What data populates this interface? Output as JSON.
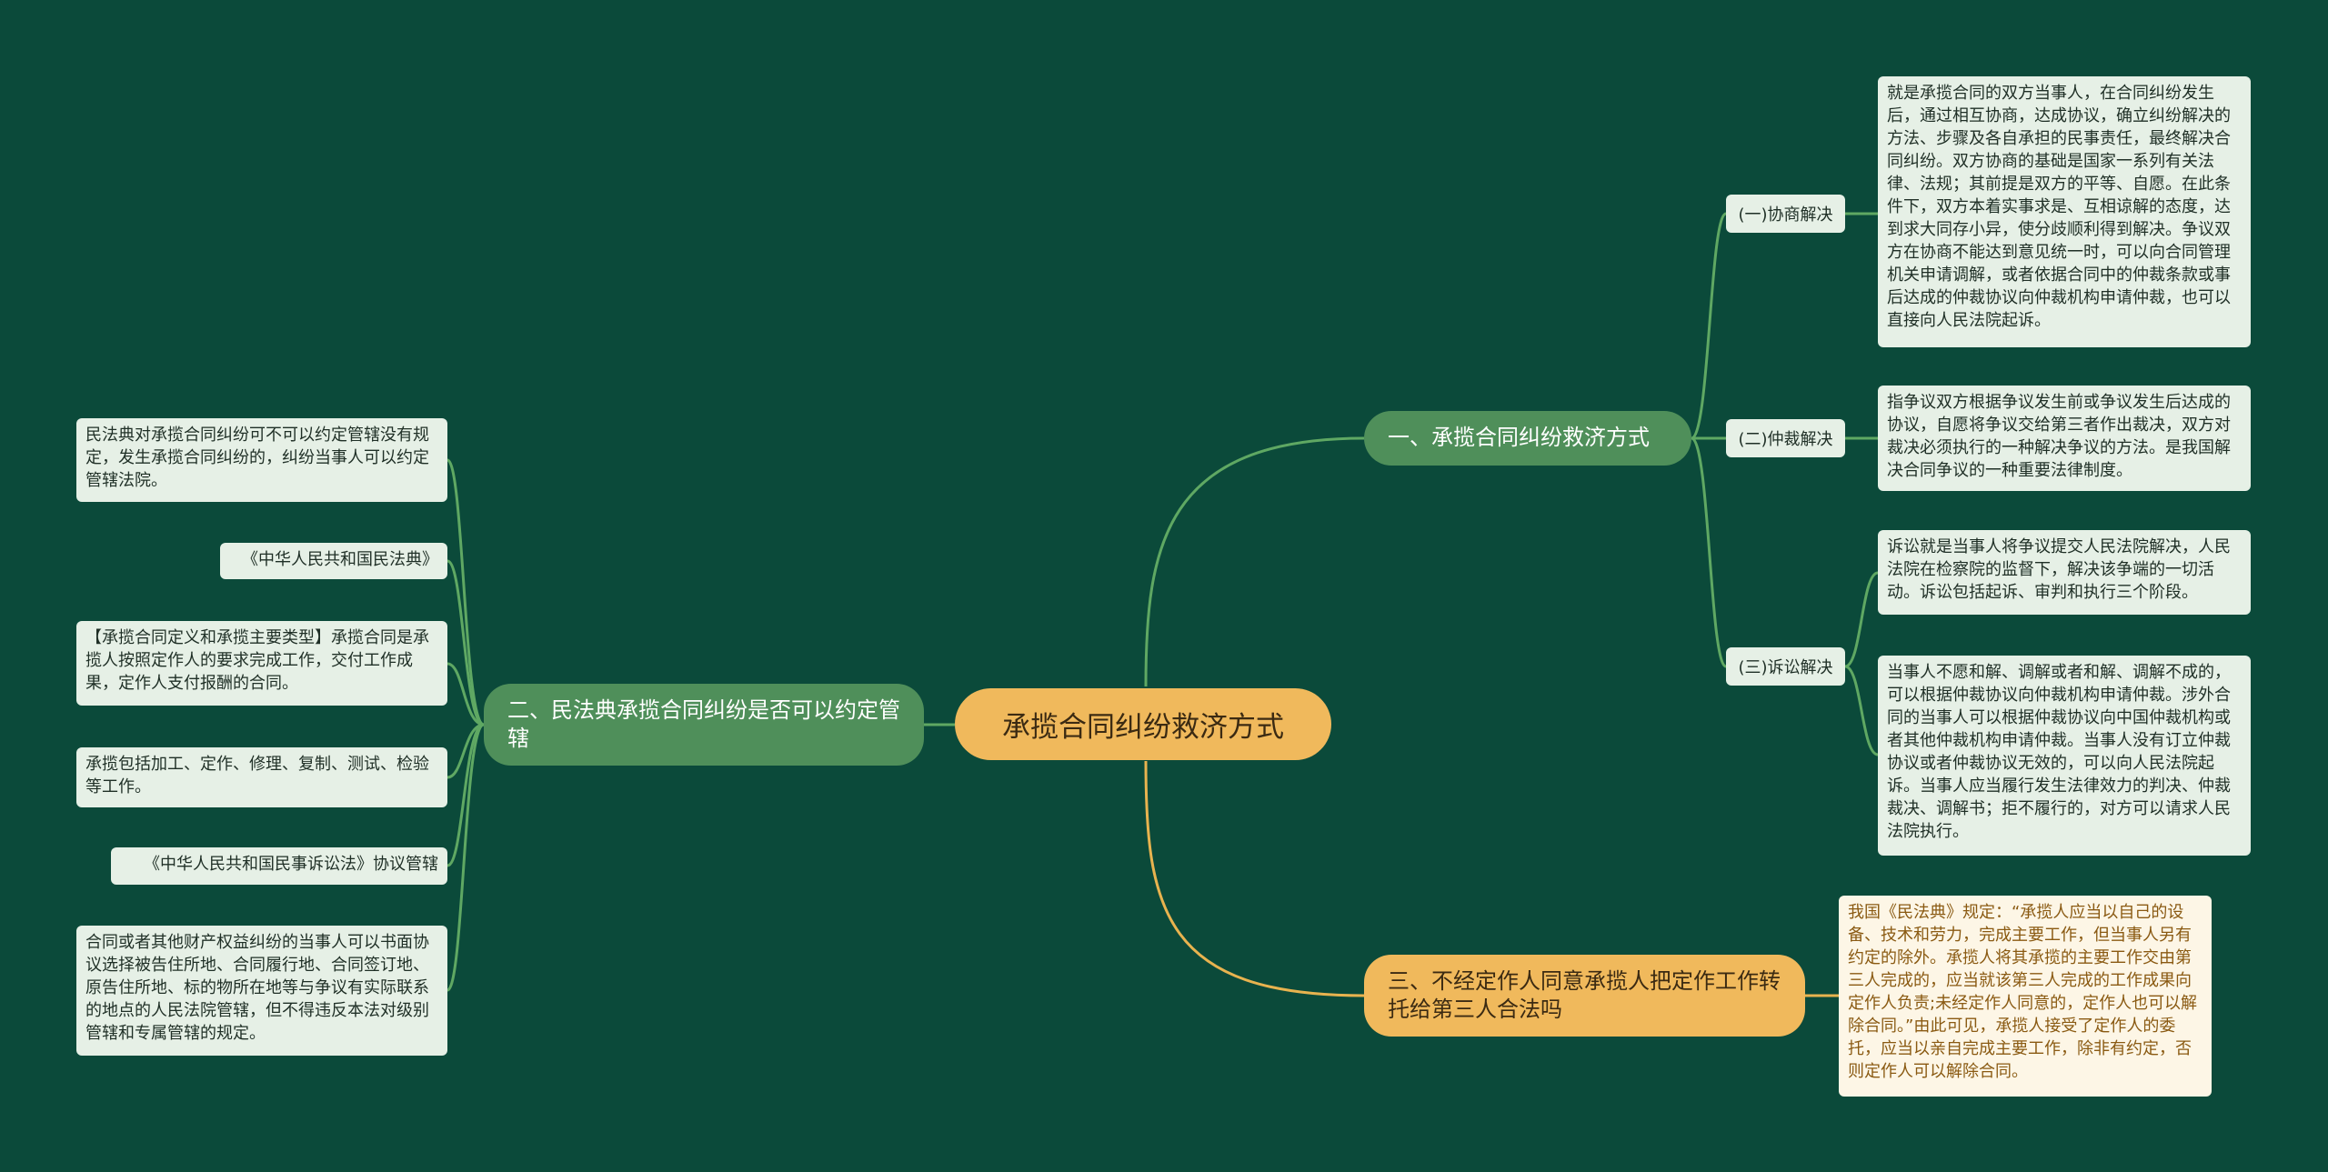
{
  "colors": {
    "background": "#0b4a3a",
    "root": "#f0b95c",
    "branch_green": "#4f8f5a",
    "branch_yellow": "#f0b95c",
    "leaf": "#e6f0e6",
    "leaf_yellow": "#fdf6e6",
    "line_green": "#5fa863",
    "line_yellow": "#e8b34f"
  },
  "root": {
    "label": "承揽合同纠纷救济方式"
  },
  "branch1": {
    "label": "一、承揽合同纠纷救济方式",
    "sub1": {
      "label": "(一)协商解决",
      "text": "就是承揽合同的双方当事人，在合同纠纷发生后，通过相互协商，达成协议，确立纠纷解决的方法、步骤及各自承担的民事责任，最终解决合同纠纷。双方协商的基础是国家一系列有关法律、法规；其前提是双方的平等、自愿。在此条件下，双方本着实事求是、互相谅解的态度，达到求大同存小异，使分歧顺利得到解决。争议双方在协商不能达到意见统一时，可以向合同管理机关申请调解，或者依据合同中的仲裁条款或事后达成的仲裁协议向仲裁机构申请仲裁，也可以直接向人民法院起诉。"
    },
    "sub2": {
      "label": "(二)仲裁解决",
      "text": "指争议双方根据争议发生前或争议发生后达成的协议，自愿将争议交给第三者作出裁决，双方对裁决必须执行的一种解决争议的方法。是我国解决合同争议的一种重要法律制度。"
    },
    "sub3": {
      "label": "(三)诉讼解决",
      "text1": "诉讼就是当事人将争议提交人民法院解决，人民法院在检察院的监督下，解决该争端的一切活动。诉讼包括起诉、审判和执行三个阶段。",
      "text2": "当事人不愿和解、调解或者和解、调解不成的，可以根据仲裁协议向仲裁机构申请仲裁。涉外合同的当事人可以根据仲裁协议向中国仲裁机构或者其他仲裁机构申请仲裁。当事人没有订立仲裁协议或者仲裁协议无效的，可以向人民法院起诉。当事人应当履行发生法律效力的判决、仲裁裁决、调解书；拒不履行的，对方可以请求人民法院执行。"
    }
  },
  "branch2": {
    "label": "二、民法典承揽合同纠纷是否可以约定管辖",
    "leaves": [
      "民法典对承揽合同纠纷可不可以约定管辖没有规定，发生承揽合同纠纷的，纠纷当事人可以约定管辖法院。",
      "《中华人民共和国民法典》",
      "【承揽合同定义和承揽主要类型】承揽合同是承揽人按照定作人的要求完成工作，交付工作成果，定作人支付报酬的合同。",
      "承揽包括加工、定作、修理、复制、测试、检验等工作。",
      "《中华人民共和国民事诉讼法》协议管辖",
      "合同或者其他财产权益纠纷的当事人可以书面协议选择被告住所地、合同履行地、合同签订地、原告住所地、标的物所在地等与争议有实际联系的地点的人民法院管辖，但不得违反本法对级别管辖和专属管辖的规定。"
    ]
  },
  "branch3": {
    "label": "三、不经定作人同意承揽人把定作工作转托给第三人合法吗",
    "text": "我国《民法典》规定：“承揽人应当以自己的设备、技术和劳力，完成主要工作，但当事人另有约定的除外。承揽人将其承揽的主要工作交由第三人完成的，应当就该第三人完成的工作成果向定作人负责;未经定作人同意的，定作人也可以解除合同。”由此可见，承揽人接受了定作人的委托，应当以亲自完成主要工作，除非有约定，否则定作人可以解除合同。"
  }
}
